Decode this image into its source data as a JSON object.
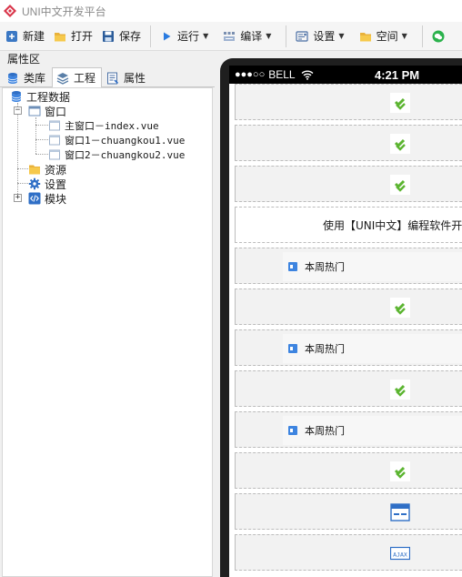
{
  "window": {
    "title": "UNI中文开发平台"
  },
  "toolbar": {
    "new_label": "新建",
    "open_label": "打开",
    "save_label": "保存",
    "run_label": "运行",
    "compile_label": "编译",
    "settings_label": "设置",
    "space_label": "空间"
  },
  "left_panel": {
    "header": "属性区",
    "tabs": {
      "library": "类库",
      "project": "工程",
      "properties": "属性"
    },
    "tree": {
      "root": "工程数据",
      "windows": "窗口",
      "win_main": "主窗口－index.vue",
      "win_1": "窗口1－chuangkou1.vue",
      "win_2": "窗口2－chuangkou2.vue",
      "resources": "资源",
      "settings": "设置",
      "modules": "模块"
    }
  },
  "device": {
    "signal": "●●●○○",
    "carrier": "BELL",
    "time": "4:21 PM"
  },
  "screen": {
    "text_component": "使用【UNI中文】编程软件开发",
    "list_item_label": "本周热门"
  },
  "colors": {
    "accent_green": "#5cb531",
    "title_gray": "#8a8a8a",
    "component_bg": "#f2f2f2"
  }
}
